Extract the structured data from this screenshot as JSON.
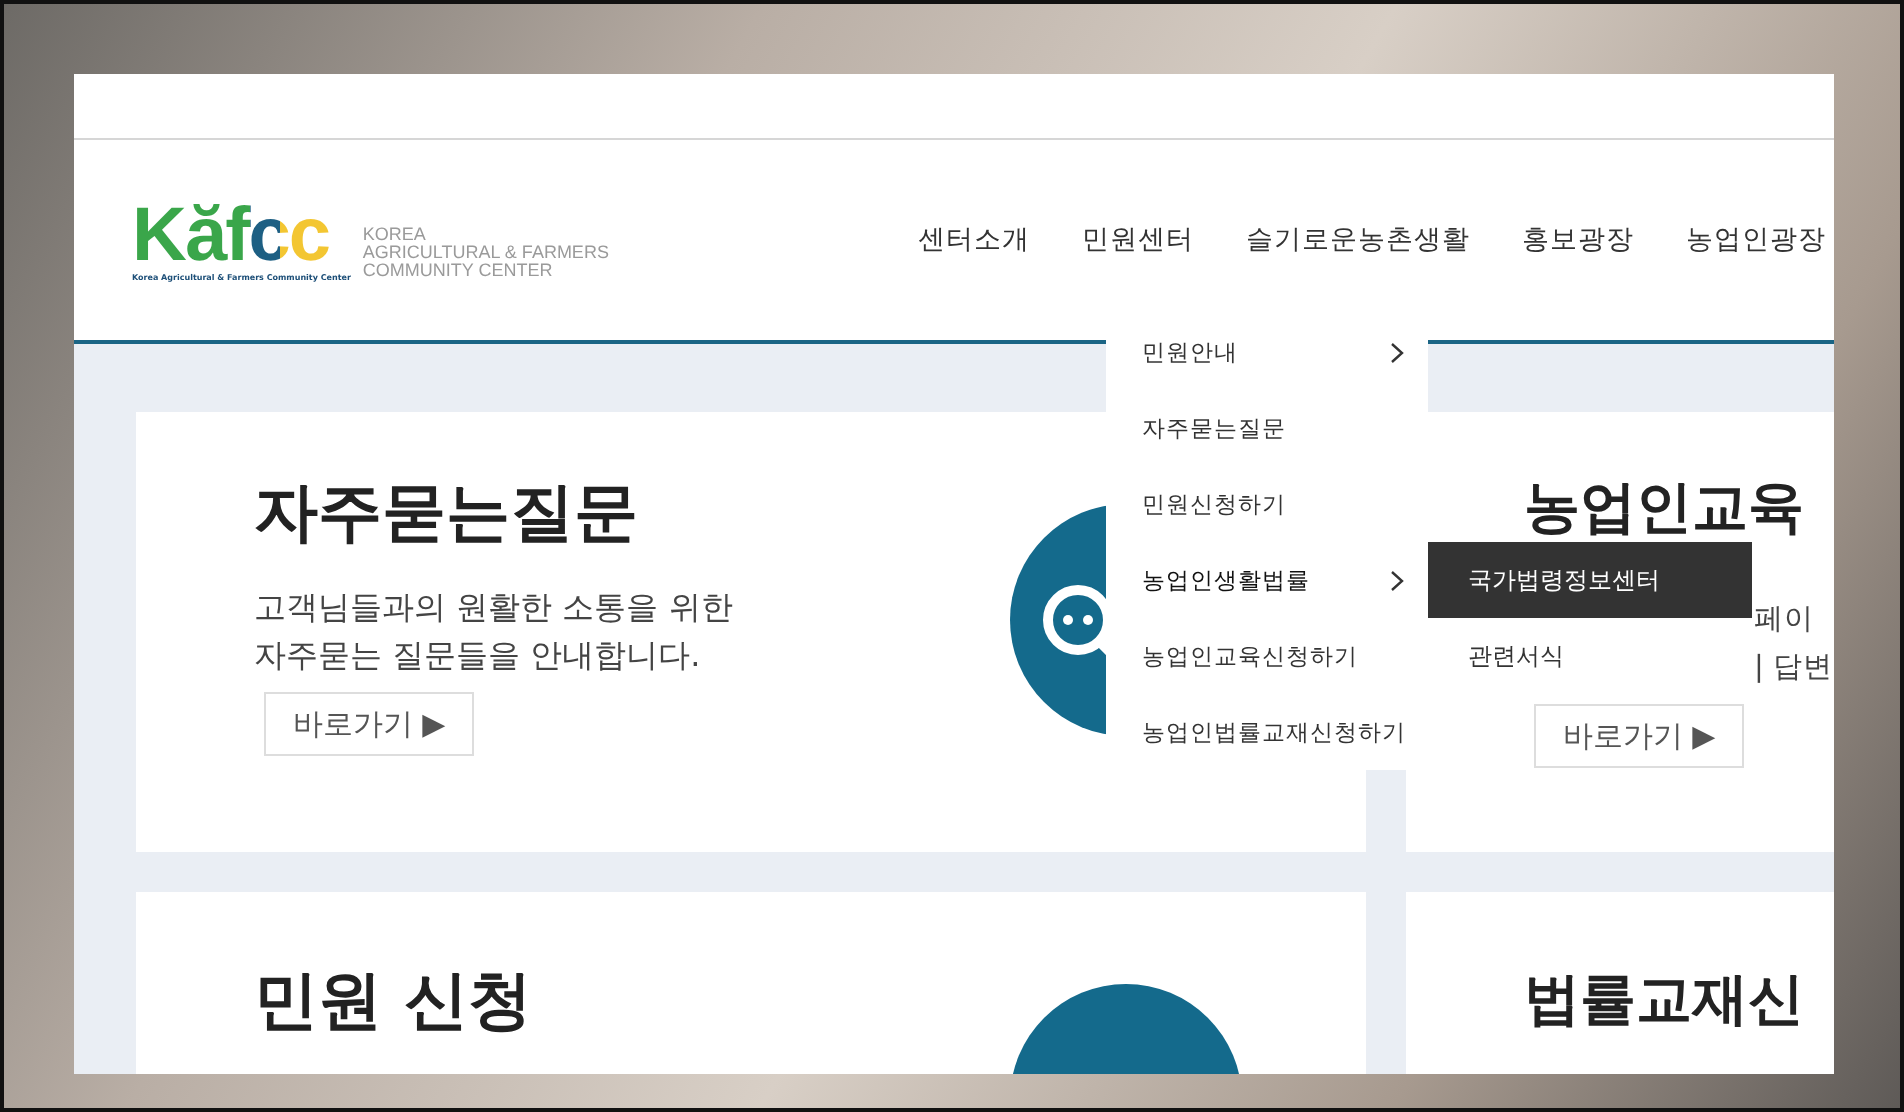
{
  "logo": {
    "mark": "Kăfcc",
    "tagline": "Korea Agricultural & Farmers Community Center",
    "name_lines": [
      "KOREA",
      "AGRICULTURAL & FARMERS",
      "COMMUNITY CENTER"
    ]
  },
  "nav": [
    "센터소개",
    "민원센터",
    "슬기로운농촌생활",
    "홍보광장",
    "농업인광장"
  ],
  "dropdown": [
    {
      "label": "민원안내",
      "has_submenu": true,
      "expanded": false
    },
    {
      "label": "자주묻는질문",
      "has_submenu": false,
      "expanded": false
    },
    {
      "label": "민원신청하기",
      "has_submenu": false,
      "expanded": false
    },
    {
      "label": "농업인생활법률",
      "has_submenu": true,
      "expanded": true
    },
    {
      "label": "농업인교육신청하기",
      "has_submenu": false,
      "expanded": false
    },
    {
      "label": "농업인법률교재신청하기",
      "has_submenu": false,
      "expanded": false
    }
  ],
  "submenu": [
    {
      "label": "국가법령정보센터",
      "selected": true
    },
    {
      "label": "관련서식",
      "selected": false
    }
  ],
  "cards": [
    {
      "title": "자주묻는질문",
      "description": [
        "고객님들과의 원활한 소통을 위한",
        "자주묻는 질문들을 안내합니다."
      ],
      "button": "바로가기 ▶"
    },
    {
      "title": "농업인교육",
      "description": [
        "페이",
        "| 답변"
      ],
      "button": "바로가기 ▶"
    },
    {
      "title": "민원 신청"
    },
    {
      "title": "법률교재신"
    }
  ]
}
